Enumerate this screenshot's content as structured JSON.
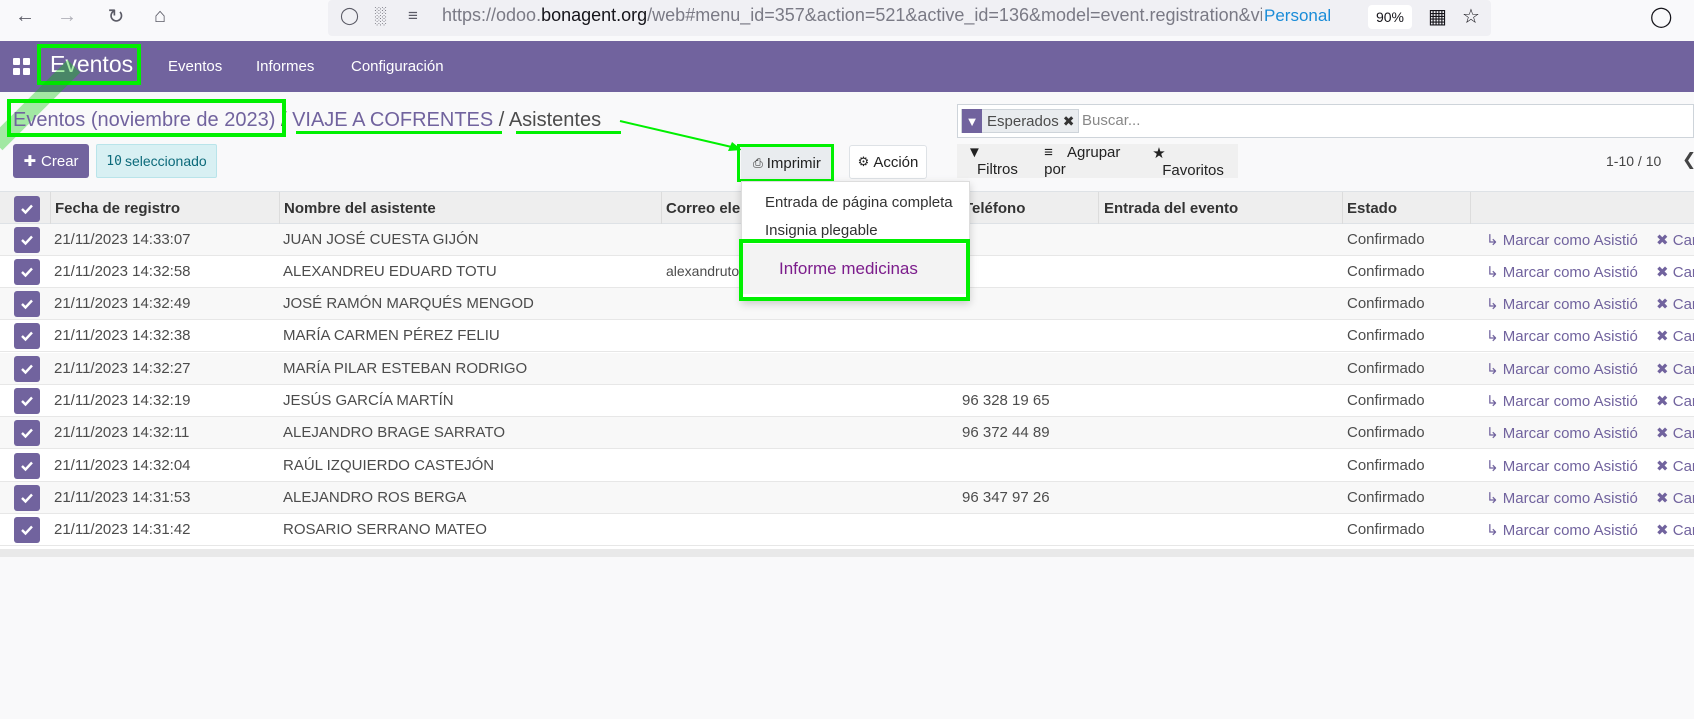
{
  "browser": {
    "url_prefix": "https://odoo.",
    "url_domain": "bonagent.org",
    "url_rest": "/web#menu_id=357&action=521&active_id=136&model=event.registration&vie",
    "profile": "Personal",
    "zoom": "90%"
  },
  "topnav": {
    "brand": "Eventos",
    "menu": [
      "Eventos",
      "Informes",
      "Configuración"
    ]
  },
  "breadcrumb": {
    "item1": "Eventos (noviembre de 2023)",
    "sep1": "/",
    "item2": "VIAJE A COFRENTES",
    "sep2": "/",
    "current": "Asistentes"
  },
  "search": {
    "facet": "Esperados",
    "placeholder": "Buscar..."
  },
  "toolbar": {
    "create_label": "Crear",
    "selected_count": "10",
    "selected_label": "seleccionado",
    "print_label": "Imprimir",
    "action_label": "Acción",
    "filters_label": "Filtros",
    "groupby_label": "Agrupar por",
    "favorites_label": "Favoritos",
    "pager": "1-10 / 10"
  },
  "print_menu": {
    "items": [
      "Entrada de página completa",
      "Insignia plegable"
    ],
    "active_item": "Informe medicinas"
  },
  "table": {
    "headers": {
      "date": "Fecha de registro",
      "name": "Nombre del asistente",
      "email": "Correo ele",
      "phone": "Teléfono",
      "ticket": "Entrada del evento",
      "state": "Estado"
    },
    "mark_label": "Marcar como Asistió",
    "cancel_label": "Can",
    "rows": [
      {
        "date": "21/11/2023 14:33:07",
        "name": "JUAN JOSÉ CUESTA GIJÓN",
        "email": "",
        "phone": "",
        "state": "Confirmado"
      },
      {
        "date": "21/11/2023 14:32:58",
        "name": "ALEXANDREU EDUARD TOTU",
        "email": "alexandruto",
        "phone": "",
        "state": "Confirmado"
      },
      {
        "date": "21/11/2023 14:32:49",
        "name": "JOSÉ RAMÓN MARQUÉS MENGOD",
        "email": "",
        "phone": "",
        "state": "Confirmado"
      },
      {
        "date": "21/11/2023 14:32:38",
        "name": "MARÍA CARMEN PÉREZ FELIU",
        "email": "",
        "phone": "",
        "state": "Confirmado"
      },
      {
        "date": "21/11/2023 14:32:27",
        "name": "MARÍA PILAR ESTEBAN RODRIGO",
        "email": "",
        "phone": "",
        "state": "Confirmado"
      },
      {
        "date": "21/11/2023 14:32:19",
        "name": "JESÚS GARCÍA MARTÍN",
        "email": "",
        "phone": "96 328 19 65",
        "state": "Confirmado"
      },
      {
        "date": "21/11/2023 14:32:11",
        "name": "ALEJANDRO BRAGE SARRATO",
        "email": "",
        "phone": "96 372 44 89",
        "state": "Confirmado"
      },
      {
        "date": "21/11/2023 14:32:04",
        "name": "RAÚL IZQUIERDO CASTEJÓN",
        "email": "",
        "phone": "",
        "state": "Confirmado"
      },
      {
        "date": "21/11/2023 14:31:53",
        "name": "ALEJANDRO ROS BERGA",
        "email": "",
        "phone": "96 347 97 26",
        "state": "Confirmado"
      },
      {
        "date": "21/11/2023 14:31:42",
        "name": "ROSARIO SERRANO MATEO",
        "email": "",
        "phone": "",
        "state": "Confirmado"
      }
    ]
  },
  "colors": {
    "brand": "#71639e",
    "highlight": "#00f000",
    "active_item": "#7c1d8c"
  }
}
